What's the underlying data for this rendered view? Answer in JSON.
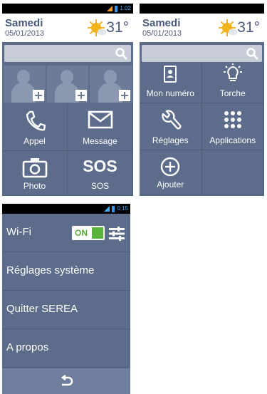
{
  "screens": [
    {
      "status": {
        "clock": "1:02"
      },
      "header": {
        "day": "Samedi",
        "date": "05/01/2013",
        "temperature": "31°",
        "weather_icon": "sun-cloud-icon"
      },
      "tiles": [
        {
          "label": "Appel",
          "icon": "phone-icon"
        },
        {
          "label": "Message",
          "icon": "envelope-icon"
        },
        {
          "label": "Photo",
          "icon": "camera-icon"
        },
        {
          "label": "SOS",
          "icon_text": "SOS"
        }
      ]
    },
    {
      "header": {
        "day": "Samedi",
        "date": "05/01/2013",
        "temperature": "31°",
        "weather_icon": "sun-cloud-icon"
      },
      "tiles": [
        {
          "label": "Mon numéro",
          "icon": "contact-card-icon"
        },
        {
          "label": "Torche",
          "icon": "lightbulb-icon"
        },
        {
          "label": "Réglages",
          "icon": "wrench-icon"
        },
        {
          "label": "Applications",
          "icon": "grid-dots-icon"
        },
        {
          "label": "Ajouter",
          "icon": "plus-circle-icon"
        }
      ]
    },
    {
      "status": {
        "clock": "0:15"
      },
      "menu": [
        {
          "label": "Wi-Fi",
          "toggle": "ON"
        },
        {
          "label": "Réglages système"
        },
        {
          "label": "Quitter SEREA"
        },
        {
          "label": "A propos"
        }
      ],
      "bottom_icon": "back-icon"
    }
  ],
  "colors": {
    "background": "#5c6c8a",
    "accent": "#3fa9f5",
    "toggle_on": "#58b43a"
  }
}
